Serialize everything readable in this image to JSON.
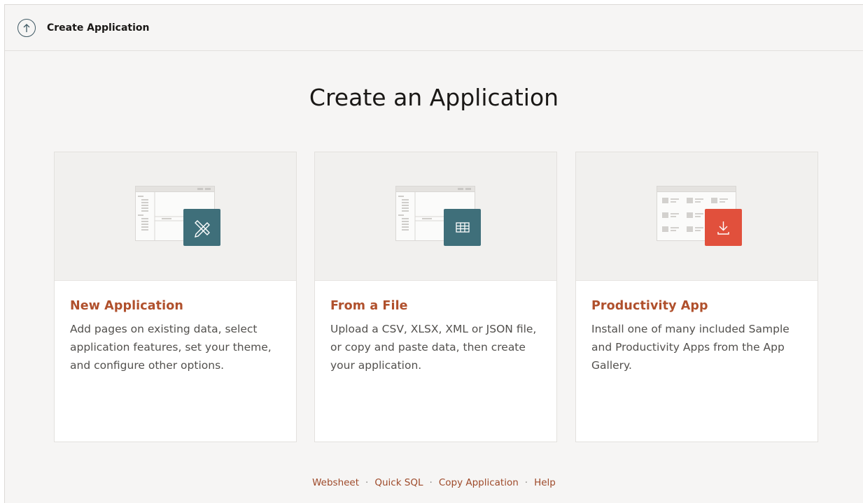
{
  "header": {
    "title": "Create Application",
    "up_icon": "arrow-up-circle-icon"
  },
  "page": {
    "title": "Create an Application"
  },
  "cards": [
    {
      "title": "New Application",
      "description": "Add pages on existing data, select application features, set your theme, and configure other options.",
      "icon": "pencil-ruler-icon",
      "badge_color": "#3f6f7a"
    },
    {
      "title": "From a File",
      "description": "Upload a CSV, XLSX, XML or JSON file, or copy and paste data, then create your application.",
      "icon": "table-grid-icon",
      "badge_color": "#3f6f7a"
    },
    {
      "title": "Productivity App",
      "description": "Install one of many included Sample and Productivity Apps from the App Gallery.",
      "icon": "download-icon",
      "badge_color": "#e1503c"
    }
  ],
  "footer": {
    "links": [
      "Websheet",
      "Quick SQL",
      "Copy Application",
      "Help"
    ],
    "separator": "·"
  },
  "colors": {
    "accent_text": "#b0502c",
    "background": "#f6f5f4",
    "badge_teal": "#3f6f7a",
    "badge_red": "#e1503c"
  }
}
